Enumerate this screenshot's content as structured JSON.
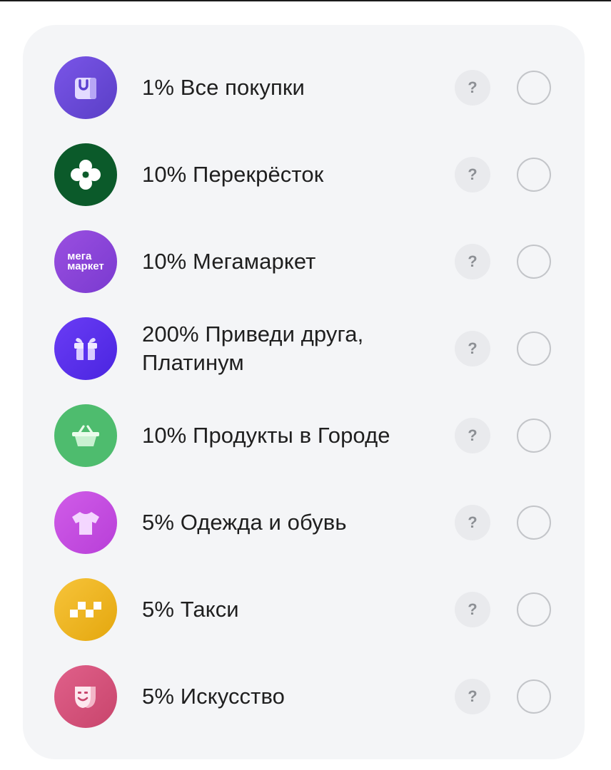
{
  "cashback_categories": [
    {
      "label": "1% Все покупки",
      "icon": "shopping-bag-icon",
      "color": "#6a4fd6",
      "help": "?",
      "selected": false
    },
    {
      "label": "10% Перекрёсток",
      "icon": "perekrestok-logo-icon",
      "color": "#0b5a2a",
      "help": "?",
      "selected": false
    },
    {
      "label": "10% Мегамаркет",
      "icon": "megamarket-logo-icon",
      "logo_text_line1": "мега",
      "logo_text_line2": "маркет",
      "color": "#8a45d6",
      "help": "?",
      "selected": false
    },
    {
      "label": "200% Приведи друга, Платинум",
      "icon": "gift-icon",
      "color": "#5b32f0",
      "help": "?",
      "selected": false
    },
    {
      "label": "10% Продукты в Городе",
      "icon": "basket-icon",
      "color": "#4ebc6e",
      "help": "?",
      "selected": false
    },
    {
      "label": "5% Одежда и обувь",
      "icon": "tshirt-icon",
      "color": "#c64ee0",
      "help": "?",
      "selected": false
    },
    {
      "label": "5% Такси",
      "icon": "taxi-checker-icon",
      "color": "#f0b91c",
      "help": "?",
      "selected": false
    },
    {
      "label": "5% Искусство",
      "icon": "theatre-mask-icon",
      "color": "#d5527a",
      "help": "?",
      "selected": false
    }
  ]
}
